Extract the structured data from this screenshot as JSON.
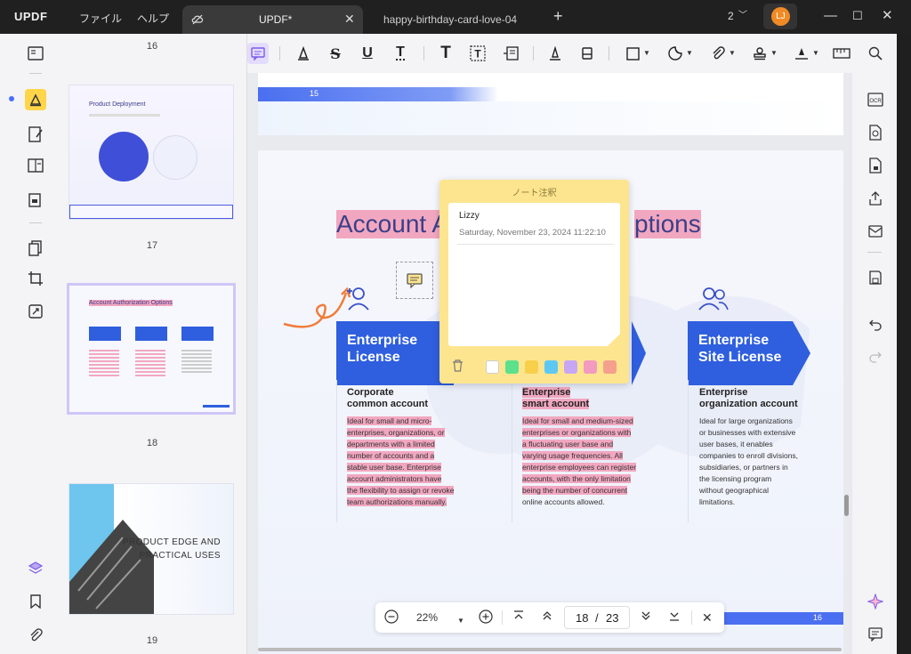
{
  "app": {
    "logo": "UPDF",
    "menus": [
      "ファイル",
      "ヘルプ"
    ],
    "tabs": [
      {
        "label": "UPDF*",
        "active": true
      },
      {
        "label": "happy-birthday-card-love-04",
        "active": false
      }
    ],
    "page_count_indicator": "2",
    "avatar_initials": "LJ",
    "accent_color": "#2f5fde",
    "highlight_color": "#f2a7c0"
  },
  "thumbnails": [
    {
      "number": "16",
      "title": "Product Deployment"
    },
    {
      "number": "17",
      "title": "Account Authorization Options",
      "selected": true
    },
    {
      "number": "18",
      "title_line1": "PRODUCT EDGE AND",
      "title_line2": "PRACTICAL USES"
    },
    {
      "number": "19"
    }
  ],
  "page15": {
    "number": "15"
  },
  "page": {
    "title_left": "Account A",
    "title_right": "ptions",
    "cards": [
      {
        "head_line1": "Enterprise",
        "head_line2": "License",
        "sub_line1": "Corporate",
        "sub_line2": "common account",
        "body": [
          "Ideal for small and micro-",
          "enterprises, organizations, or",
          "departments with a limited",
          "number of accounts and a",
          "stable user base. Enterprise",
          "account administrators have",
          "the flexibility to assign or revoke",
          "team authorizations manually."
        ]
      },
      {
        "sub_line1": "Enterprise",
        "sub_line2": "smart account",
        "body": [
          "Ideal for small and medium-sized",
          "enterprises or organizations with",
          "a fluctuating user base and",
          "varying usage frequencies. All",
          "enterprise employees can register",
          "accounts, with the only limitation",
          "being the number of concurrent",
          "online accounts allowed."
        ]
      },
      {
        "head_line1": "Enterprise",
        "head_line2": "Site License",
        "sub_line1": "Enterprise",
        "sub_line2": "organization account",
        "body": [
          "Ideal for large organizations",
          "or businesses with extensive",
          "user bases, it enables",
          "companies to enroll divisions,",
          "subsidiaries, or partners in",
          "the licensing program",
          "without geographical",
          "limitations."
        ]
      }
    ],
    "footer_number": "16"
  },
  "note": {
    "header": "ノート注釈",
    "author": "Lizzy",
    "timestamp": "Saturday, November 23, 2024 11:22:10",
    "colors": [
      "#ffffff",
      "#5ce08c",
      "#f8cf4a",
      "#5fc8f2",
      "#c7a7f5",
      "#f39ac0",
      "#f5a08c"
    ]
  },
  "zoom": {
    "level": "22%",
    "current_page": "18",
    "separator": "/",
    "total_pages": "23"
  }
}
